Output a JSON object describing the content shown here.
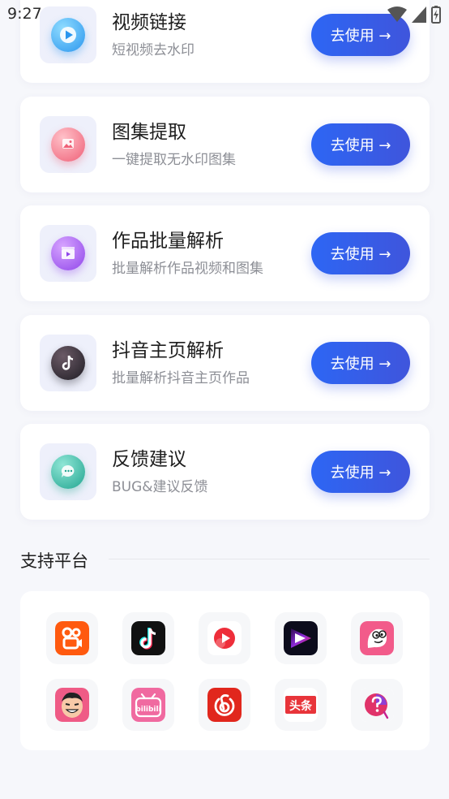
{
  "status_bar": {
    "time": "9:27"
  },
  "features": [
    {
      "title": "视频链接",
      "subtitle": "短视频去水印",
      "button": "去使用 →",
      "icon": "video-play-icon",
      "color": "#2fa6f2"
    },
    {
      "title": "图集提取",
      "subtitle": "一键提取无水印图集",
      "button": "去使用 →",
      "icon": "image-gallery-icon",
      "color": "#f07184"
    },
    {
      "title": "作品批量解析",
      "subtitle": "批量解析作品视频和图集",
      "button": "去使用 →",
      "icon": "batch-clapper-icon",
      "color": "#a75bf0"
    },
    {
      "title": "抖音主页解析",
      "subtitle": "批量解析抖音主页作品",
      "button": "去使用 →",
      "icon": "douyin-note-icon",
      "color": "#2a2a32"
    },
    {
      "title": "反馈建议",
      "subtitle": "BUG&建议反馈",
      "button": "去使用 →",
      "icon": "feedback-chat-icon",
      "color": "#2fb5a3"
    }
  ],
  "platforms_section": {
    "title": "支持平台"
  },
  "platforms": [
    {
      "icon": "kuaishou-logo-icon",
      "color": "#ff5a0f"
    },
    {
      "icon": "douyin-logo-icon",
      "color": "#111111"
    },
    {
      "icon": "red-play-logo-icon",
      "color": "#ee2e3a"
    },
    {
      "icon": "watermelon-video-logo-icon",
      "color": "#8b2bd9"
    },
    {
      "icon": "pipixia-logo-icon",
      "color": "#f25b8a"
    },
    {
      "icon": "zuiyou-logo-icon",
      "color": "#ef5b86"
    },
    {
      "icon": "bilibili-logo-icon",
      "color": "#f06aa0"
    },
    {
      "icon": "netease-music-logo-icon",
      "color": "#e1271d"
    },
    {
      "icon": "toutiao-logo-icon",
      "color": "#e8343a"
    },
    {
      "icon": "question-app-logo-icon",
      "color": "#e0336a"
    }
  ]
}
